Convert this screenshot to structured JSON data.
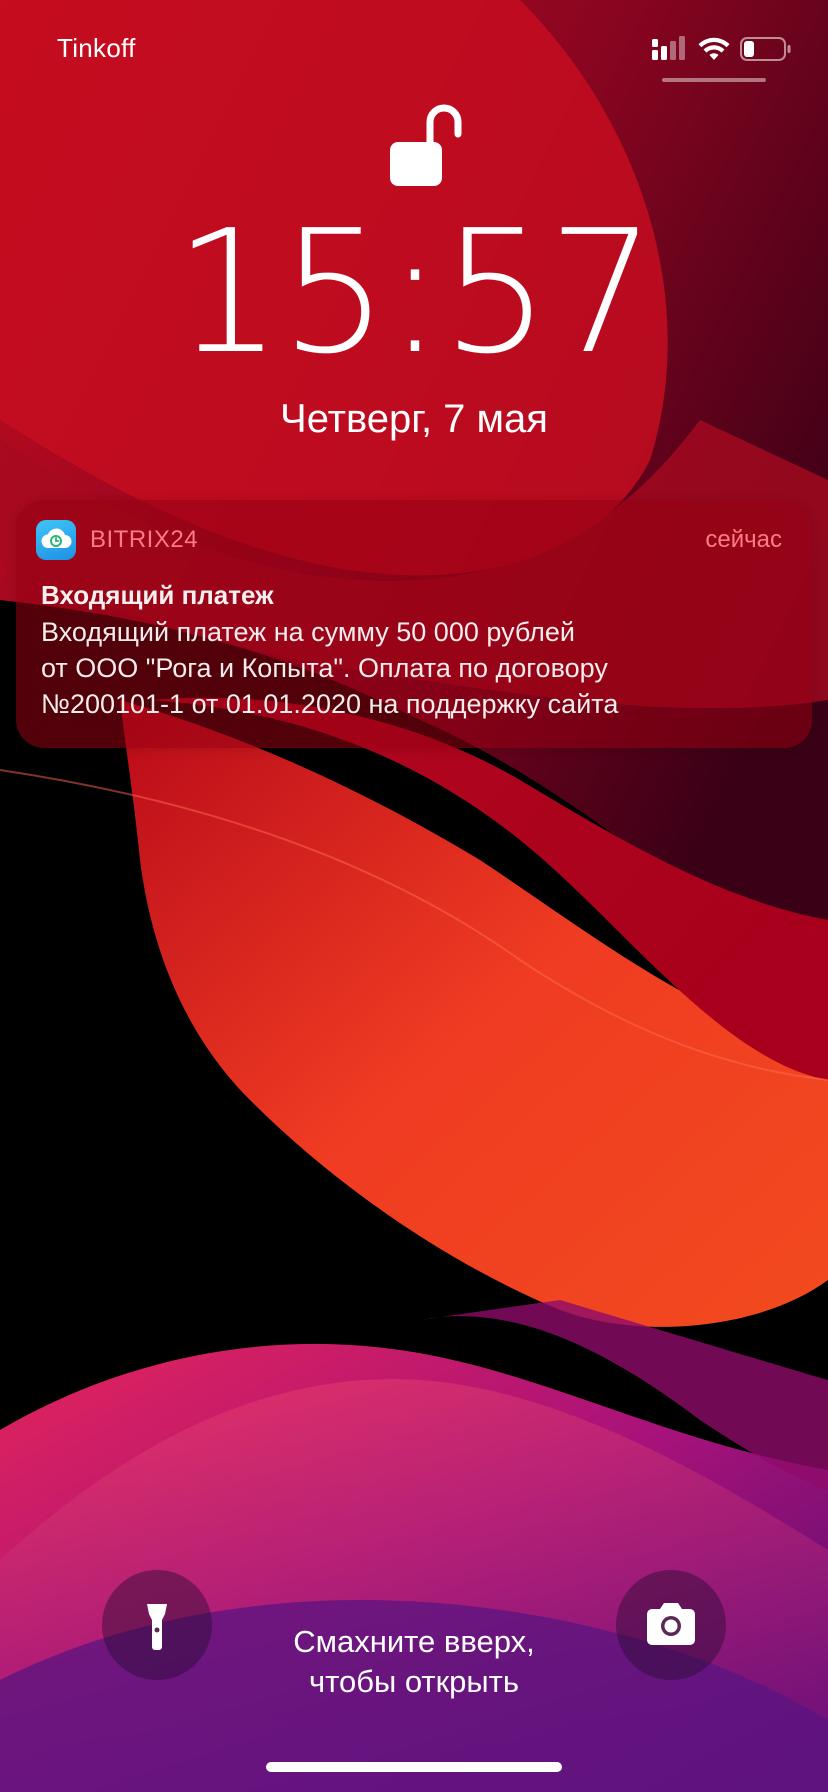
{
  "status_bar": {
    "carrier": "Tinkoff",
    "battery_level": 0.25
  },
  "lock_screen": {
    "time": "15:57",
    "date": "Четверг, 7 мая",
    "lock_state": "unlocked"
  },
  "notification": {
    "app_name": "BITRIX24",
    "app_icon": "bitrix24-cloud-icon",
    "time": "сейчас",
    "title": "Входящий платеж",
    "body_lines": [
      "Входящий платеж на сумму 50 000 рублей",
      "от ООО \"Рога и Копыта\". Оплата по договору",
      "№200101-1 от 01.01.2020 на поддержку сайта"
    ]
  },
  "bottom": {
    "swipe_hint_line1": "Смахните вверх,",
    "swipe_hint_line2": "чтобы открыть",
    "left_button_icon": "flashlight-icon",
    "right_button_icon": "camera-icon"
  },
  "colors": {
    "notification_accent": "#ff7b86",
    "wallpaper_primary": "#d3122a",
    "wallpaper_secondary": "#ff4a2a",
    "wallpaper_tertiary": "#c21a7e"
  }
}
